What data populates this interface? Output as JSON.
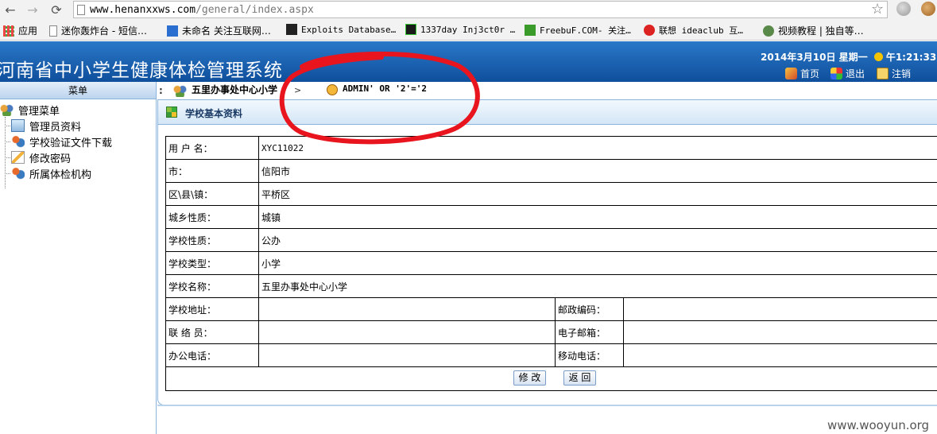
{
  "browser": {
    "url_host": "www.henanxxws.com",
    "url_path": "/general/index.aspx",
    "bookmarks": [
      {
        "label": "应用",
        "icon": "apps-grid-icon"
      },
      {
        "label": "迷你轰炸台 - 短信…",
        "icon": "page-icon"
      },
      {
        "label": "未命名 关注互联网…",
        "icon": "mb-icon"
      },
      {
        "label": "Exploits Database…",
        "icon": "exploitdb-icon"
      },
      {
        "label": "1337day Inj3ct0r …",
        "icon": "1337day-icon"
      },
      {
        "label": "FreebuF.COM- 关注…",
        "icon": "freebuf-icon"
      },
      {
        "label": "联想 ideaclub 互…",
        "icon": "lenovo-icon"
      },
      {
        "label": "视频教程 | 独自等…",
        "icon": "avatar-icon"
      }
    ]
  },
  "header": {
    "title": "河南省中小学生健康体检管理系统",
    "date": "2014年3月10日  星期一",
    "time": "午1:21:33",
    "links": [
      "首页",
      "退出",
      "注销"
    ]
  },
  "sidebar": {
    "heading": "菜单",
    "root": "管理菜单",
    "items": [
      "管理员资料",
      "学校验证文件下载",
      "修改密码",
      "所属体检机构"
    ]
  },
  "breadcrumb": {
    "dots": ":",
    "school": "五里办事处中心小学",
    "sep": ">",
    "user": "ADMIN' OR '2'='2"
  },
  "panel": {
    "title": "学校基本资料",
    "rows": [
      {
        "label": "用 户 名：",
        "value": "XYC11022"
      },
      {
        "label": "市：",
        "value": "信阳市"
      },
      {
        "label": "区\\县\\镇：",
        "value": "平桥区"
      },
      {
        "label": "城乡性质：",
        "value": "城镇"
      },
      {
        "label": "学校性质：",
        "value": "公办"
      },
      {
        "label": "学校类型：",
        "value": "小学"
      },
      {
        "label": "学校名称：",
        "value": "五里办事处中心小学"
      }
    ],
    "pairs": [
      {
        "label": "学校地址：",
        "value": "",
        "label2": "邮政编码：",
        "value2": ""
      },
      {
        "label": "联 络 员：",
        "value": "",
        "label2": "电子邮箱：",
        "value2": ""
      },
      {
        "label": "办公电话：",
        "value": "",
        "label2": "移动电话：",
        "value2": ""
      }
    ],
    "edit_button": "修 改",
    "back_button": "返 回"
  },
  "watermark": "www.wooyun.org",
  "colors": {
    "header_blue": "#1a62b4",
    "annotation_red": "#e8141e"
  }
}
